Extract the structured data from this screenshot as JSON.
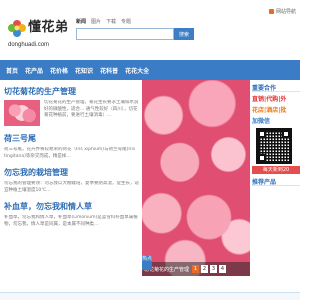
{
  "header": {
    "logo_text": "懂花弟",
    "logo_domain": "donghuadi.com",
    "links": [
      "网站导航"
    ],
    "search": {
      "tabs": [
        "新闻",
        "图片",
        "下载",
        "专题"
      ],
      "active_tab": 0,
      "placeholder": "",
      "button_label": "搜索"
    }
  },
  "nav": {
    "items": [
      "首页",
      "花产品",
      "花价格",
      "花知识",
      "花科普",
      "花花大全"
    ],
    "color": "#3a7cc5"
  },
  "articles": [
    {
      "title": "切花菊花的生产管理",
      "body": "切花菊花的生产管理，菊花生长要求土壤排水良好的微酸性，适合... 通气性较好（四川），切花菊花种植前，要进行土壤消毒）..."
    },
    {
      "title": "荷三号尾",
      "body": "荷三号尾，花卉界将较易荣的荷花（Iris xiphium)与荷兰号尾(Iris tingitana)等杂交而成，精是样..."
    },
    {
      "title": "勿忘我的栽培管理",
      "body": "勿忘我的管理要领：勿忘我以大棚栽培，夏季要防高温，促生长，适宜种植土壤温度10℃..."
    },
    {
      "title": "补血草，勿忘我和情人草",
      "body": "补血草，勿忘我和情人草，补血草(Limonium)是蓝雪科补血草属植物，勿忘我，情人草是同属，是本属不同种类..."
    }
  ],
  "slider": {
    "caption": "切花菊花的生产管理",
    "pages": [
      "1",
      "2",
      "3",
      "4"
    ],
    "active_page": 0,
    "side_label": "热点"
  },
  "sidebar": {
    "title": "重要合作",
    "ad_lines": [
      {
        "text": "直销|代购|外",
        "color": "#e83333"
      },
      {
        "text": "花店|酒店|批",
        "color": "#e87b1a"
      },
      {
        "text": "加微信",
        "color": "#3a7cc5"
      }
    ],
    "qr_label": "每天新到20",
    "bottom_title": "推荐产品"
  },
  "colors": {
    "primary": "#3a7cc5",
    "title_blue": "#2e6db4",
    "accent_orange": "#e86a2a",
    "slide_pink": "#e04e71"
  }
}
